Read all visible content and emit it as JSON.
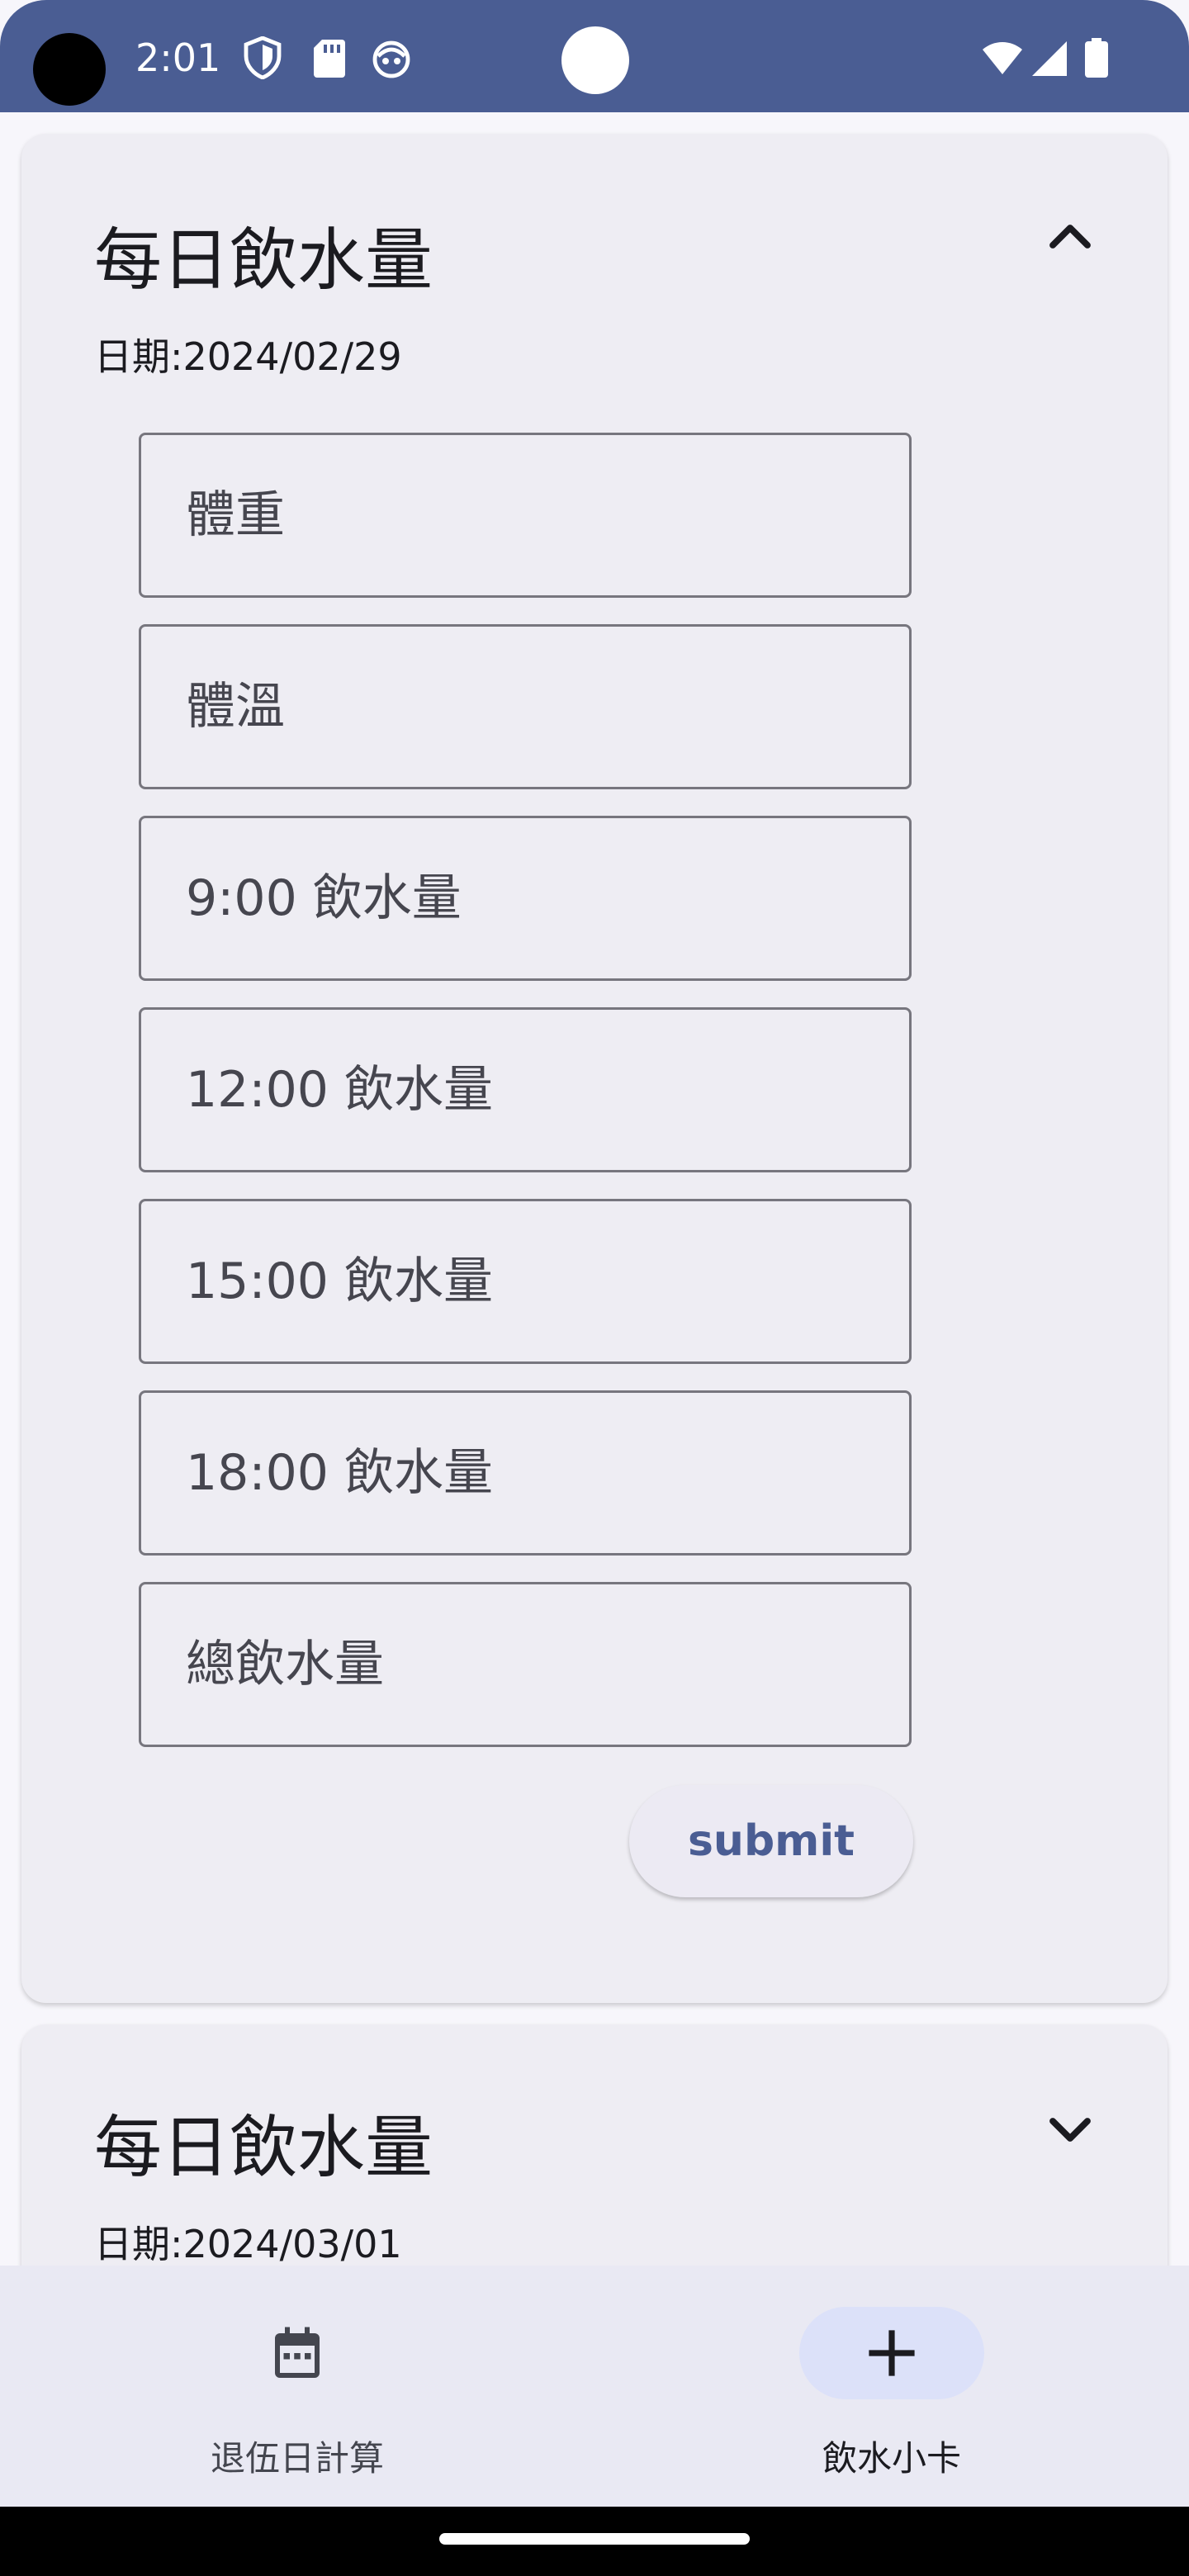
{
  "status_bar": {
    "time": "2:01",
    "left_icons": [
      "shield-icon",
      "sd-card-icon",
      "android-face-icon"
    ],
    "right_icons": [
      "wifi-icon",
      "signal-icon",
      "battery-icon"
    ]
  },
  "cards": [
    {
      "title": "每日飲水量",
      "date": "日期:2024/02/29",
      "expanded": true,
      "fields": [
        {
          "placeholder": "體重",
          "value": ""
        },
        {
          "placeholder": "體溫",
          "value": ""
        },
        {
          "placeholder": "9:00 飲水量",
          "value": ""
        },
        {
          "placeholder": "12:00 飲水量",
          "value": ""
        },
        {
          "placeholder": "15:00 飲水量",
          "value": ""
        },
        {
          "placeholder": "18:00 飲水量",
          "value": ""
        },
        {
          "placeholder": "總飲水量",
          "value": ""
        }
      ],
      "submit_label": "submit"
    },
    {
      "title": "每日飲水量",
      "date": "日期:2024/03/01",
      "expanded": false
    }
  ],
  "bottom_nav": {
    "items": [
      {
        "label": "退伍日計算",
        "icon": "calendar-icon",
        "active": false
      },
      {
        "label": "飲水小卡",
        "icon": "add-icon",
        "active": true
      }
    ]
  },
  "colors": {
    "primary": "#4a5d93",
    "card_bg": "#eeedf3",
    "nav_bg": "#e9e9f3",
    "active_indicator": "#dce1f9"
  }
}
